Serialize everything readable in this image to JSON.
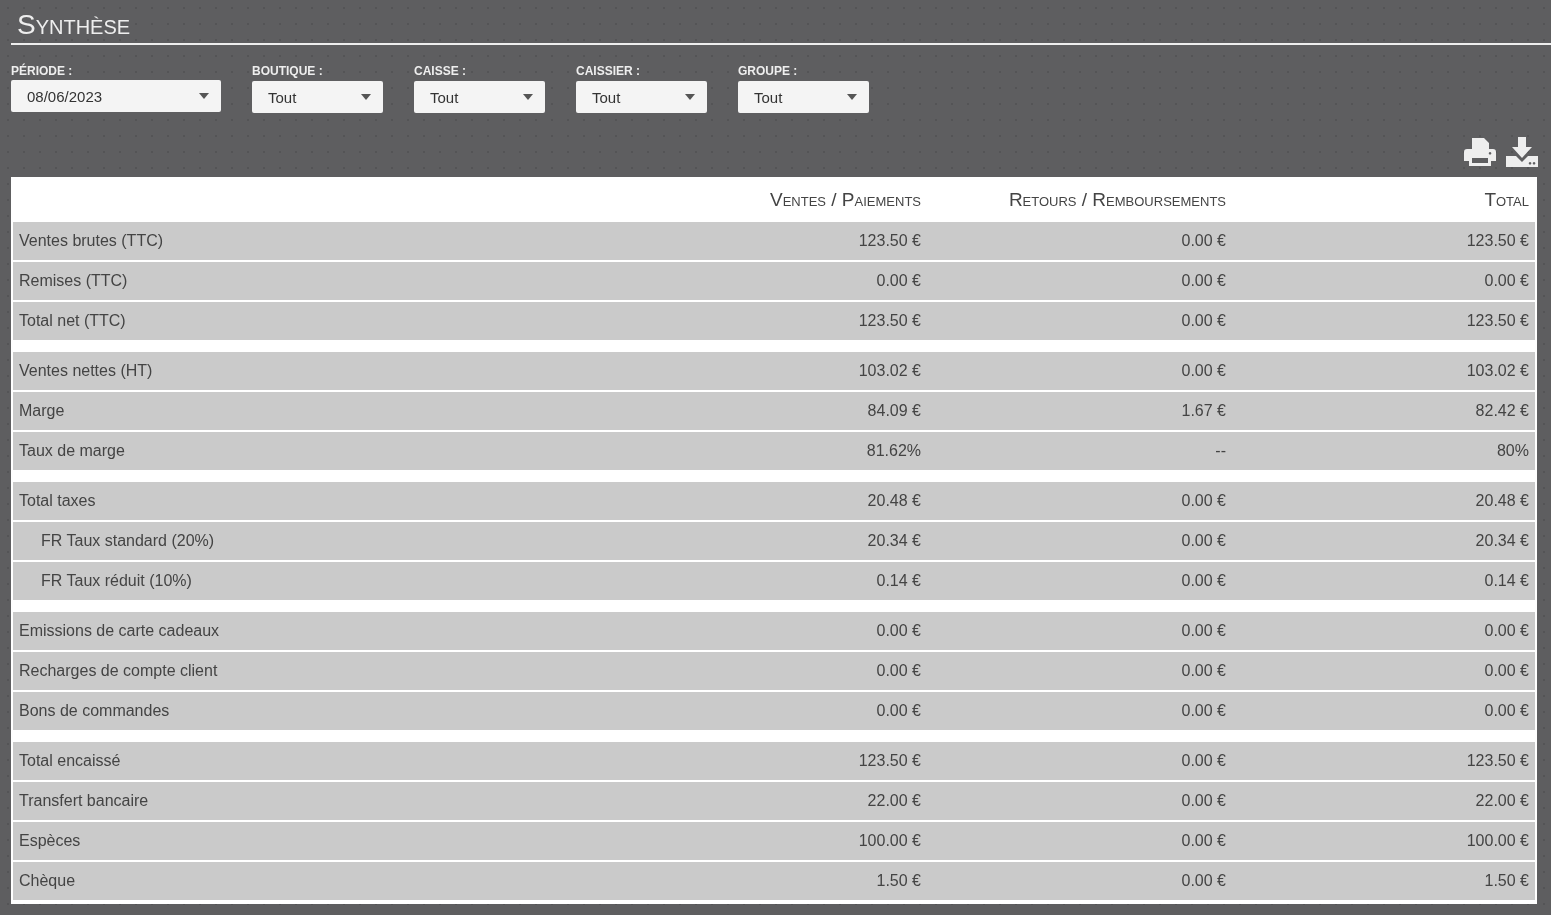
{
  "title": "Synthèse",
  "filters": [
    {
      "label": "PÉRIODE :",
      "value": "08/06/2023"
    },
    {
      "label": "BOUTIQUE :",
      "value": "Tout"
    },
    {
      "label": "CAISSE :",
      "value": "Tout"
    },
    {
      "label": "CAISSIER :",
      "value": "Tout"
    },
    {
      "label": "GROUPE :",
      "value": "Tout"
    }
  ],
  "table": {
    "columns": [
      "Ventes / Paiements",
      "Retours / Remboursements",
      "Total"
    ],
    "groups": [
      {
        "rows": [
          {
            "label": "Ventes brutes (TTC)",
            "values": [
              "123.50 €",
              "0.00 €",
              "123.50 €"
            ]
          },
          {
            "label": "Remises (TTC)",
            "values": [
              "0.00 €",
              "0.00 €",
              "0.00 €"
            ]
          },
          {
            "label": "Total net (TTC)",
            "values": [
              "123.50 €",
              "0.00 €",
              "123.50 €"
            ]
          }
        ]
      },
      {
        "rows": [
          {
            "label": "Ventes nettes (HT)",
            "values": [
              "103.02 €",
              "0.00 €",
              "103.02 €"
            ]
          },
          {
            "label": "Marge",
            "values": [
              "84.09 €",
              "1.67 €",
              "82.42 €"
            ]
          },
          {
            "label": "Taux de marge",
            "values": [
              "81.62%",
              "--",
              "80%"
            ]
          }
        ]
      },
      {
        "rows": [
          {
            "label": "Total taxes",
            "values": [
              "20.48 €",
              "0.00 €",
              "20.48 €"
            ],
            "children": [
              {
                "label": "FR Taux standard (20%)",
                "values": [
                  "20.34 €",
                  "0.00 €",
                  "20.34 €"
                ]
              },
              {
                "label": "FR Taux réduit (10%)",
                "values": [
                  "0.14 €",
                  "0.00 €",
                  "0.14 €"
                ]
              }
            ]
          }
        ]
      },
      {
        "rows": [
          {
            "label": "Emissions de carte cadeaux",
            "values": [
              "0.00 €",
              "0.00 €",
              "0.00 €"
            ]
          },
          {
            "label": "Recharges de compte client",
            "values": [
              "0.00 €",
              "0.00 €",
              "0.00 €"
            ]
          },
          {
            "label": "Bons de commandes",
            "values": [
              "0.00 €",
              "0.00 €",
              "0.00 €"
            ]
          }
        ]
      },
      {
        "rows": [
          {
            "label": "Total encaissé",
            "values": [
              "123.50 €",
              "0.00 €",
              "123.50 €"
            ]
          },
          {
            "label": "Transfert bancaire",
            "values": [
              "22.00 €",
              "0.00 €",
              "22.00 €"
            ]
          },
          {
            "label": "Espèces",
            "values": [
              "100.00 €",
              "0.00 €",
              "100.00 €"
            ]
          },
          {
            "label": "Chèque",
            "values": [
              "1.50 €",
              "0.00 €",
              "1.50 €"
            ]
          }
        ]
      }
    ]
  }
}
